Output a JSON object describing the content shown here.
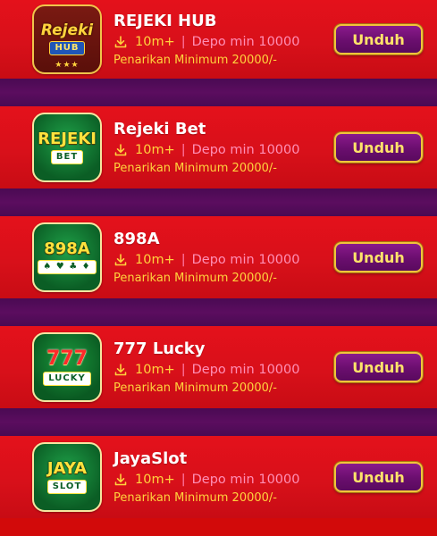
{
  "apps": [
    {
      "name": "REJEKI HUB",
      "downloads": "10m+",
      "deposit": "Depo min 10000",
      "withdraw": "Penarikan Minimum 20000/-",
      "button": "Unduh",
      "icon": {
        "name": "rejeki-hub-app-icon",
        "top": "Rejeki",
        "bottom": "HUB",
        "style": "gold",
        "extra": "★★★"
      }
    },
    {
      "name": "Rejeki Bet",
      "downloads": "10m+",
      "deposit": "Depo min 10000",
      "withdraw": "Penarikan Minimum 20000/-",
      "button": "Unduh",
      "icon": {
        "name": "rejeki-bet-app-icon",
        "top": "REJEKI",
        "bottom": "BET",
        "style": "green",
        "extra": "♠ ♥ ♣"
      }
    },
    {
      "name": "898A",
      "downloads": "10m+",
      "deposit": "Depo min 10000",
      "withdraw": "Penarikan Minimum 20000/-",
      "button": "Unduh",
      "icon": {
        "name": "898a-app-icon",
        "top": "898A",
        "bottom": "♠ ♥ ♣ ♦",
        "style": "green",
        "extra": ""
      }
    },
    {
      "name": "777 Lucky",
      "downloads": "10m+",
      "deposit": "Depo min 10000",
      "withdraw": "Penarikan Minimum 20000/-",
      "button": "Unduh",
      "icon": {
        "name": "777-lucky-app-icon",
        "top": "777",
        "bottom": "LUCKY",
        "style": "red",
        "extra": ""
      }
    },
    {
      "name": "JayaSlot",
      "downloads": "10m+",
      "deposit": "Depo min 10000",
      "withdraw": "Penarikan Minimum 20000/-",
      "button": "Unduh",
      "icon": {
        "name": "jayaslot-app-icon",
        "top": "JAYA",
        "bottom": "SLOT",
        "style": "green",
        "extra": ""
      }
    }
  ],
  "colors": {
    "card": "#d20a0a",
    "separator": "#4a0a53",
    "button": "#6a0e6e",
    "button_border": "#f2c43a",
    "text_gold": "#ffd33d",
    "text_pink": "#ff8fb6"
  }
}
